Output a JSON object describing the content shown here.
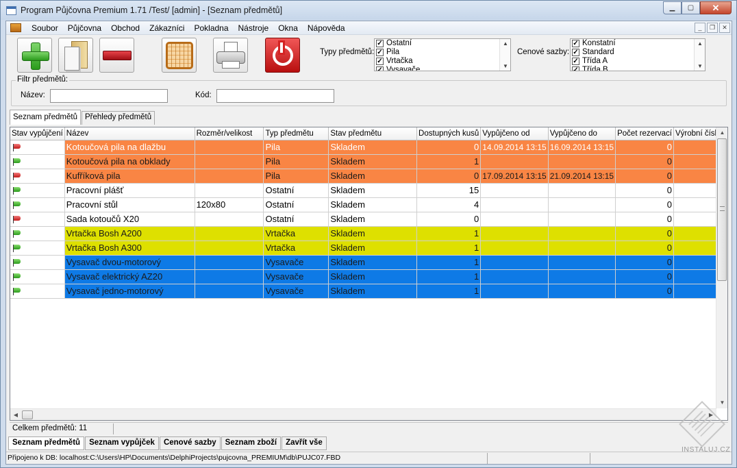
{
  "window": {
    "title": "Program Půjčovna Premium 1.71 /Test/ [admin] - [Seznam předmětů]",
    "minimize_glyph": "▁",
    "maximize_glyph": "▢",
    "close_glyph": "✕"
  },
  "menu": {
    "items": [
      "Soubor",
      "Půjčovna",
      "Obchod",
      "Zákazníci",
      "Pokladna",
      "Nástroje",
      "Okna",
      "Nápověda"
    ],
    "mdi_minimize": "_",
    "mdi_restore": "❐",
    "mdi_close": "✕"
  },
  "toolbar": {
    "buttons": [
      {
        "icon": "plus-icon"
      },
      {
        "icon": "document-folder-icon"
      },
      {
        "icon": "minus-icon"
      },
      {
        "icon": "calendar-icon"
      },
      {
        "icon": "printer-icon"
      },
      {
        "icon": "power-icon"
      }
    ],
    "item_types_label": "Typy předmětů:",
    "item_types": [
      {
        "label": "Ostatní",
        "checked": true
      },
      {
        "label": "Pila",
        "checked": true
      },
      {
        "label": "Vrtačka",
        "checked": true
      },
      {
        "label": "Vysavače",
        "checked": true
      }
    ],
    "price_rates_label": "Cenové sazby:",
    "price_rates": [
      {
        "label": "Konstatní",
        "checked": true
      },
      {
        "label": "Standard",
        "checked": true
      },
      {
        "label": "Třída A",
        "checked": true
      },
      {
        "label": "Třída B",
        "checked": true
      }
    ],
    "check_glyph": "✓",
    "scroll_up": "▲",
    "scroll_down": "▼"
  },
  "filter": {
    "title": "Filtr předmětů:",
    "name_label": "Název:",
    "name_value": "",
    "code_label": "Kód:",
    "code_value": ""
  },
  "tabs": {
    "top": [
      "Seznam předmětů",
      "Přehledy předmětů"
    ],
    "bottom": [
      "Seznam předmětů",
      "Seznam vypůjček",
      "Cenové sazby",
      "Seznam zboží",
      "Zavřít vše"
    ]
  },
  "grid": {
    "columns": [
      "Stav vypůjčení",
      "Název",
      "Rozměr/velikost",
      "Typ předmětu",
      "Stav předmětu",
      "Dostupných kusů",
      "Vypůjčeno od",
      "Vypůjčeno do",
      "Počet rezervací",
      "Výrobní číslo"
    ],
    "rows": [
      {
        "flag": "red",
        "color": "orange",
        "selected": true,
        "name": "Kotoučová pila na dlažbu",
        "size": "",
        "type": "Pila",
        "status": "Skladem",
        "available": "0",
        "from": "14.09.2014 13:15",
        "to": "16.09.2014 13:15",
        "reservations": "0",
        "serial": ""
      },
      {
        "flag": "green",
        "color": "orange",
        "selected": false,
        "name": "Kotoučová pila na obklady",
        "size": "",
        "type": "Pila",
        "status": "Skladem",
        "available": "1",
        "from": "",
        "to": "",
        "reservations": "0",
        "serial": ""
      },
      {
        "flag": "red",
        "color": "orange",
        "selected": false,
        "name": "Kufříková pila",
        "size": "",
        "type": "Pila",
        "status": "Skladem",
        "available": "0",
        "from": "17.09.2014 13:15",
        "to": "21.09.2014 13:15",
        "reservations": "0",
        "serial": ""
      },
      {
        "flag": "green",
        "color": "white",
        "selected": false,
        "name": "Pracovní plášť",
        "size": "",
        "type": "Ostatní",
        "status": "Skladem",
        "available": "15",
        "from": "",
        "to": "",
        "reservations": "0",
        "serial": ""
      },
      {
        "flag": "green",
        "color": "white",
        "selected": false,
        "name": "Pracovní stůl",
        "size": "120x80",
        "type": "Ostatní",
        "status": "Skladem",
        "available": "4",
        "from": "",
        "to": "",
        "reservations": "0",
        "serial": ""
      },
      {
        "flag": "red",
        "color": "white",
        "selected": false,
        "name": "Sada kotoučů X20",
        "size": "",
        "type": "Ostatní",
        "status": "Skladem",
        "available": "0",
        "from": "",
        "to": "",
        "reservations": "0",
        "serial": ""
      },
      {
        "flag": "green",
        "color": "yellow",
        "selected": false,
        "name": "Vrtačka Bosh A200",
        "size": "",
        "type": "Vrtačka",
        "status": "Skladem",
        "available": "1",
        "from": "",
        "to": "",
        "reservations": "0",
        "serial": ""
      },
      {
        "flag": "green",
        "color": "yellow",
        "selected": false,
        "name": "Vrtačka Bosh A300",
        "size": "",
        "type": "Vrtačka",
        "status": "Skladem",
        "available": "1",
        "from": "",
        "to": "",
        "reservations": "0",
        "serial": ""
      },
      {
        "flag": "green",
        "color": "blue",
        "selected": false,
        "name": "Vysavač dvou-motorový",
        "size": "",
        "type": "Vysavače",
        "status": "Skladem",
        "available": "1",
        "from": "",
        "to": "",
        "reservations": "0",
        "serial": ""
      },
      {
        "flag": "green",
        "color": "blue",
        "selected": false,
        "name": "Vysavač elektrický AZ20",
        "size": "",
        "type": "Vysavače",
        "status": "Skladem",
        "available": "1",
        "from": "",
        "to": "",
        "reservations": "0",
        "serial": ""
      },
      {
        "flag": "green",
        "color": "blue",
        "selected": false,
        "name": "Vysavač jedno-motorový",
        "size": "",
        "type": "Vysavače",
        "status": "Skladem",
        "available": "1",
        "from": "",
        "to": "",
        "reservations": "0",
        "serial": ""
      }
    ],
    "row_colors": {
      "orange": "#f98544",
      "yellow": "#dee000",
      "blue": "#0e7ae6",
      "white": "#ffffff"
    },
    "scroll_up": "▲",
    "scroll_down": "▼",
    "scroll_left": "◀",
    "scroll_right": "▶"
  },
  "status": {
    "count": "Celkem předmětů: 11",
    "connection": "Připojeno k DB: localhost:C:\\Users\\HP\\Documents\\DelphiProjects\\pujcovna_PREMIUM\\db\\PUJC07.FBD"
  },
  "watermark": {
    "text": "INSTALUJ.CZ"
  }
}
